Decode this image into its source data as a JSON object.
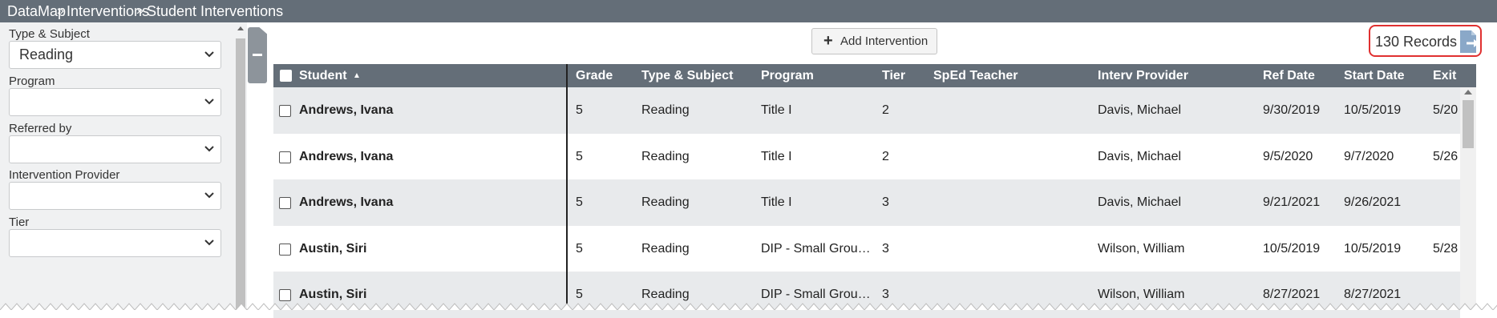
{
  "breadcrumb": [
    "DataMap",
    "Interventions",
    "Student Interventions"
  ],
  "breadcrumb_separator": "»",
  "filters": [
    {
      "label": "Type & Subject",
      "value": "Reading"
    },
    {
      "label": "Program",
      "value": ""
    },
    {
      "label": "Referred by",
      "value": ""
    },
    {
      "label": "Intervention Provider",
      "value": ""
    },
    {
      "label": "Tier",
      "value": ""
    }
  ],
  "toolbar": {
    "add_label": "Add Intervention",
    "records_label": "130 Records"
  },
  "table": {
    "sort_indicator": "▲",
    "columns": [
      "Student",
      "Grade",
      "Type & Subject",
      "Program",
      "Tier",
      "SpEd Teacher",
      "Interv Provider",
      "Ref Date",
      "Start Date",
      "Exit"
    ],
    "rows": [
      [
        "Andrews, Ivana",
        "5",
        "Reading",
        "Title I",
        "2",
        "",
        "Davis, Michael",
        "9/30/2019",
        "10/5/2019",
        "5/20"
      ],
      [
        "Andrews, Ivana",
        "5",
        "Reading",
        "Title I",
        "2",
        "",
        "Davis, Michael",
        "9/5/2020",
        "9/7/2020",
        "5/26"
      ],
      [
        "Andrews, Ivana",
        "5",
        "Reading",
        "Title I",
        "3",
        "",
        "Davis, Michael",
        "9/21/2021",
        "9/26/2021",
        ""
      ],
      [
        "Austin, Siri",
        "5",
        "Reading",
        "DIP - Small Grou…",
        "3",
        "",
        "Wilson, William",
        "10/5/2019",
        "10/5/2019",
        "5/28"
      ],
      [
        "Austin, Siri",
        "5",
        "Reading",
        "DIP - Small Grou…",
        "3",
        "",
        "Wilson, William",
        "8/27/2021",
        "8/27/2021",
        ""
      ]
    ]
  },
  "colors": {
    "header_bg": "#646e78",
    "row_alt": "#e8eaec",
    "highlight": "#e03030",
    "export_icon": "#8aa8c8"
  },
  "icons": [
    "chevron-down-icon",
    "plus-icon",
    "export-icon",
    "collapse-icon"
  ]
}
